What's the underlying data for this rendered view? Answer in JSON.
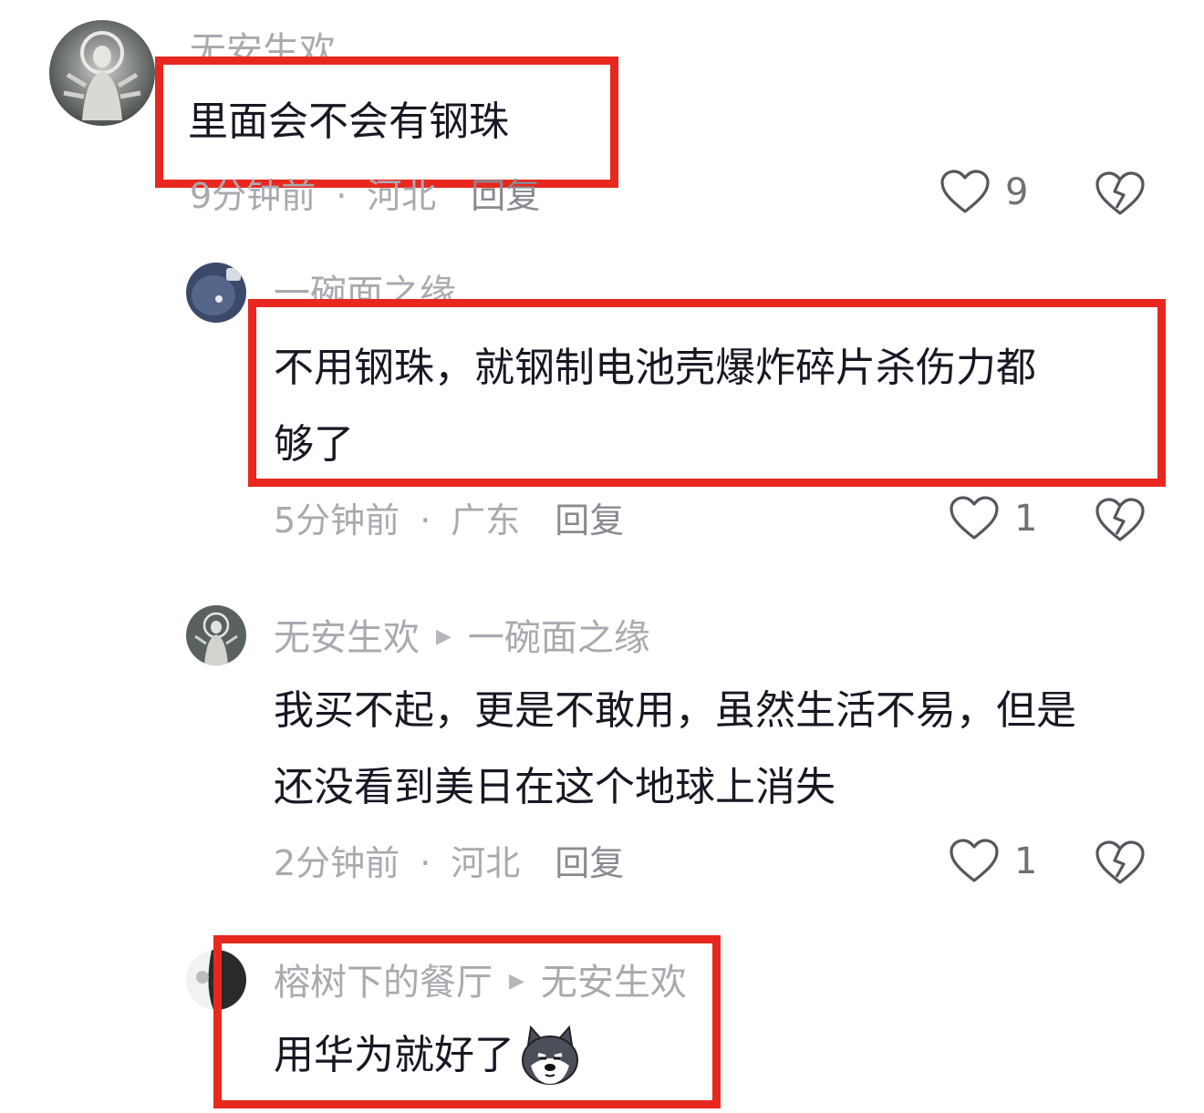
{
  "comments": [
    {
      "author": "无安生欢",
      "text": "里面会不会有钢珠",
      "time": "9分钟前",
      "location": "河北",
      "reply_label": "回复",
      "likes": "9"
    },
    {
      "author": "一碗面之缘",
      "text_line1": "不用钢珠，就钢制电池壳爆炸碎片杀伤力都",
      "text_line2": "够了",
      "time": "5分钟前",
      "location": "广东",
      "reply_label": "回复",
      "likes": "1"
    },
    {
      "author": "无安生欢",
      "reply_to": "一碗面之缘",
      "text_line1": "我买不起，更是不敢用，虽然生活不易，但是",
      "text_line2": "还没看到美日在这个地球上消失",
      "time": "2分钟前",
      "location": "河北",
      "reply_label": "回复",
      "likes": "1"
    },
    {
      "author": "榕树下的餐厅",
      "reply_to": "无安生欢",
      "text": "用华为就好了",
      "emoji": "husky-dog-emoji"
    }
  ],
  "colors": {
    "highlight_box": "#e8281e",
    "meta_text": "#a9aab0",
    "body_text": "#161823"
  }
}
